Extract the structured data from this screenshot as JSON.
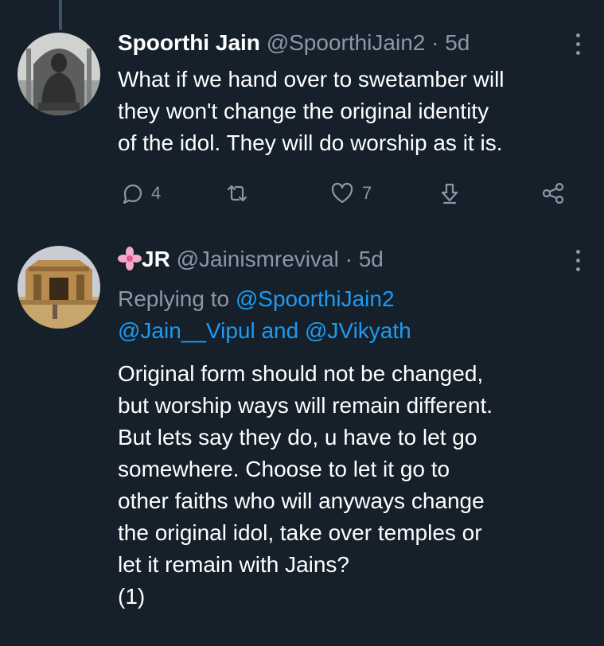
{
  "tweets": [
    {
      "author_name": "Spoorthi Jain",
      "handle": "@SpoorthiJain2",
      "separator": "·",
      "time": "5d",
      "body_lines": [
        "What if we hand over to swetamber will",
        "they won't change the original identity",
        "of the idol. They will do worship as it is."
      ],
      "actions": {
        "reply_count": "4",
        "retweet_count": "",
        "like_count": "7",
        "icons": [
          "reply-icon",
          "retweet-icon",
          "like-icon",
          "download-icon",
          "share-icon"
        ]
      }
    },
    {
      "author_name": "JR",
      "name_emoji": "flower-icon",
      "handle": "@Jainismrevival",
      "separator": "·",
      "time": "5d",
      "replying_prefix": "Replying to",
      "replying_to_1": "@SpoorthiJain2",
      "replying_to_2": "@Jain__Vipul",
      "replying_and": "and",
      "replying_to_3": "@JVikyath",
      "body_lines": [
        "Original form should not be changed,",
        "but worship ways will remain different.",
        "But lets say they do, u have to let go",
        "somewhere. Choose to let it go to",
        "other faiths who will anyways change",
        "the original idol, take over temples or",
        "let it remain with Jains?",
        "(1)"
      ]
    }
  ],
  "colors": {
    "background": "#15202b",
    "secondary_text": "#8b98a5",
    "link": "#1d9bf0",
    "thread_line": "#3d5466"
  }
}
